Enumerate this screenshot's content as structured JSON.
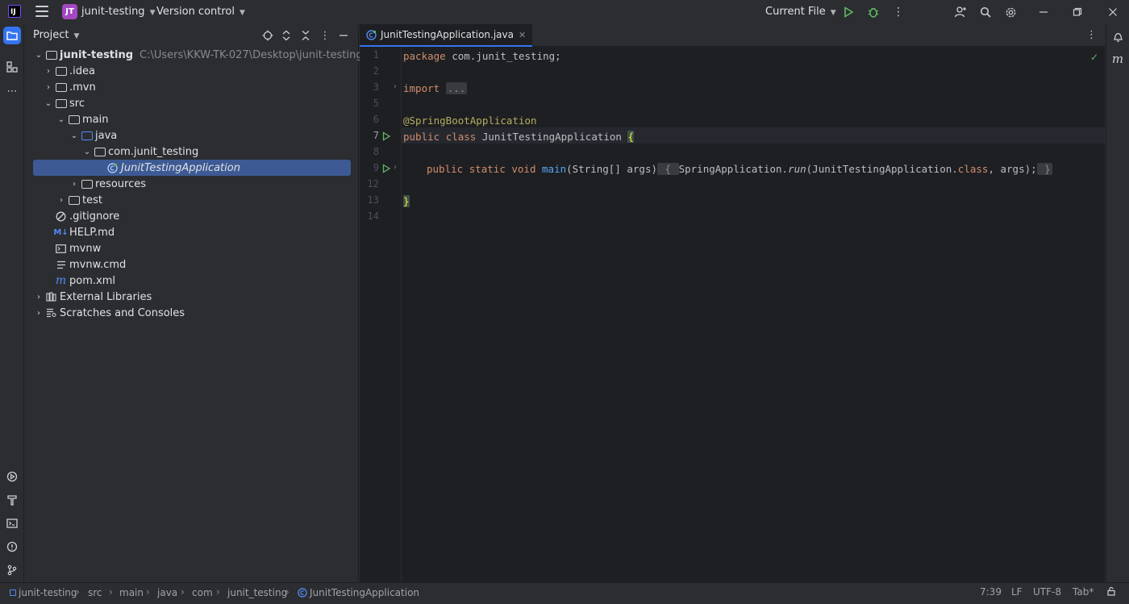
{
  "titlebar": {
    "logo_text": "IJ",
    "project_badge": "JT",
    "project_name": "junit-testing",
    "vcs_label": "Version control",
    "run_config": "Current File",
    "icons": [
      "menu-icon",
      "run-icon",
      "debug-icon",
      "more-icon",
      "add-user-icon",
      "search-icon",
      "settings-icon",
      "minimize-icon",
      "restore-icon",
      "close-icon"
    ]
  },
  "project_panel": {
    "title": "Project",
    "tree": [
      {
        "label": "junit-testing",
        "hint": "C:\\Users\\KKW-TK-027\\Desktop\\junit-testing"
      },
      {
        "label": ".idea"
      },
      {
        "label": ".mvn"
      },
      {
        "label": "src"
      },
      {
        "label": "main"
      },
      {
        "label": "java"
      },
      {
        "label": "com.junit_testing"
      },
      {
        "label": "JunitTestingApplication"
      },
      {
        "label": "resources"
      },
      {
        "label": "test"
      },
      {
        "label": ".gitignore"
      },
      {
        "label": "HELP.md"
      },
      {
        "label": "mvnw"
      },
      {
        "label": "mvnw.cmd"
      },
      {
        "label": "pom.xml"
      },
      {
        "label": "External Libraries"
      },
      {
        "label": "Scratches and Consoles"
      }
    ]
  },
  "editor": {
    "tab_label": "JunitTestingApplication.java",
    "line_numbers": [
      "1",
      "2",
      "3",
      "5",
      "6",
      "7",
      "8",
      "9",
      "12",
      "13",
      "14"
    ],
    "code": {
      "l1_kw": "package",
      "l1_rest": " com.junit_testing;",
      "l3_kw": "import",
      "l3_fold": "...",
      "l6_ann": "@SpringBootApplication",
      "l7_kw1": "public",
      "l7_kw2": "class",
      "l7_name": " JunitTestingApplication ",
      "l7_brace": "{",
      "l9_kw1": "public",
      "l9_kw2": "static",
      "l9_kw3": "void",
      "l9_fn": "main",
      "l9_params": "(String[] args)",
      "l9_open": " { ",
      "l9_call": "SpringApplication.",
      "l9_run": "run",
      "l9_args_a": "(JunitTestingApplication.",
      "l9_class": "class",
      "l9_args_b": ", args);",
      "l9_close": " }",
      "l13_brace": "}"
    }
  },
  "statusbar": {
    "breadcrumbs": [
      "junit-testing",
      "src",
      "main",
      "java",
      "com",
      "junit_testing",
      "JunitTestingApplication"
    ],
    "position": "7:39",
    "line_sep": "LF",
    "encoding": "UTF-8",
    "indent": "Tab*"
  }
}
